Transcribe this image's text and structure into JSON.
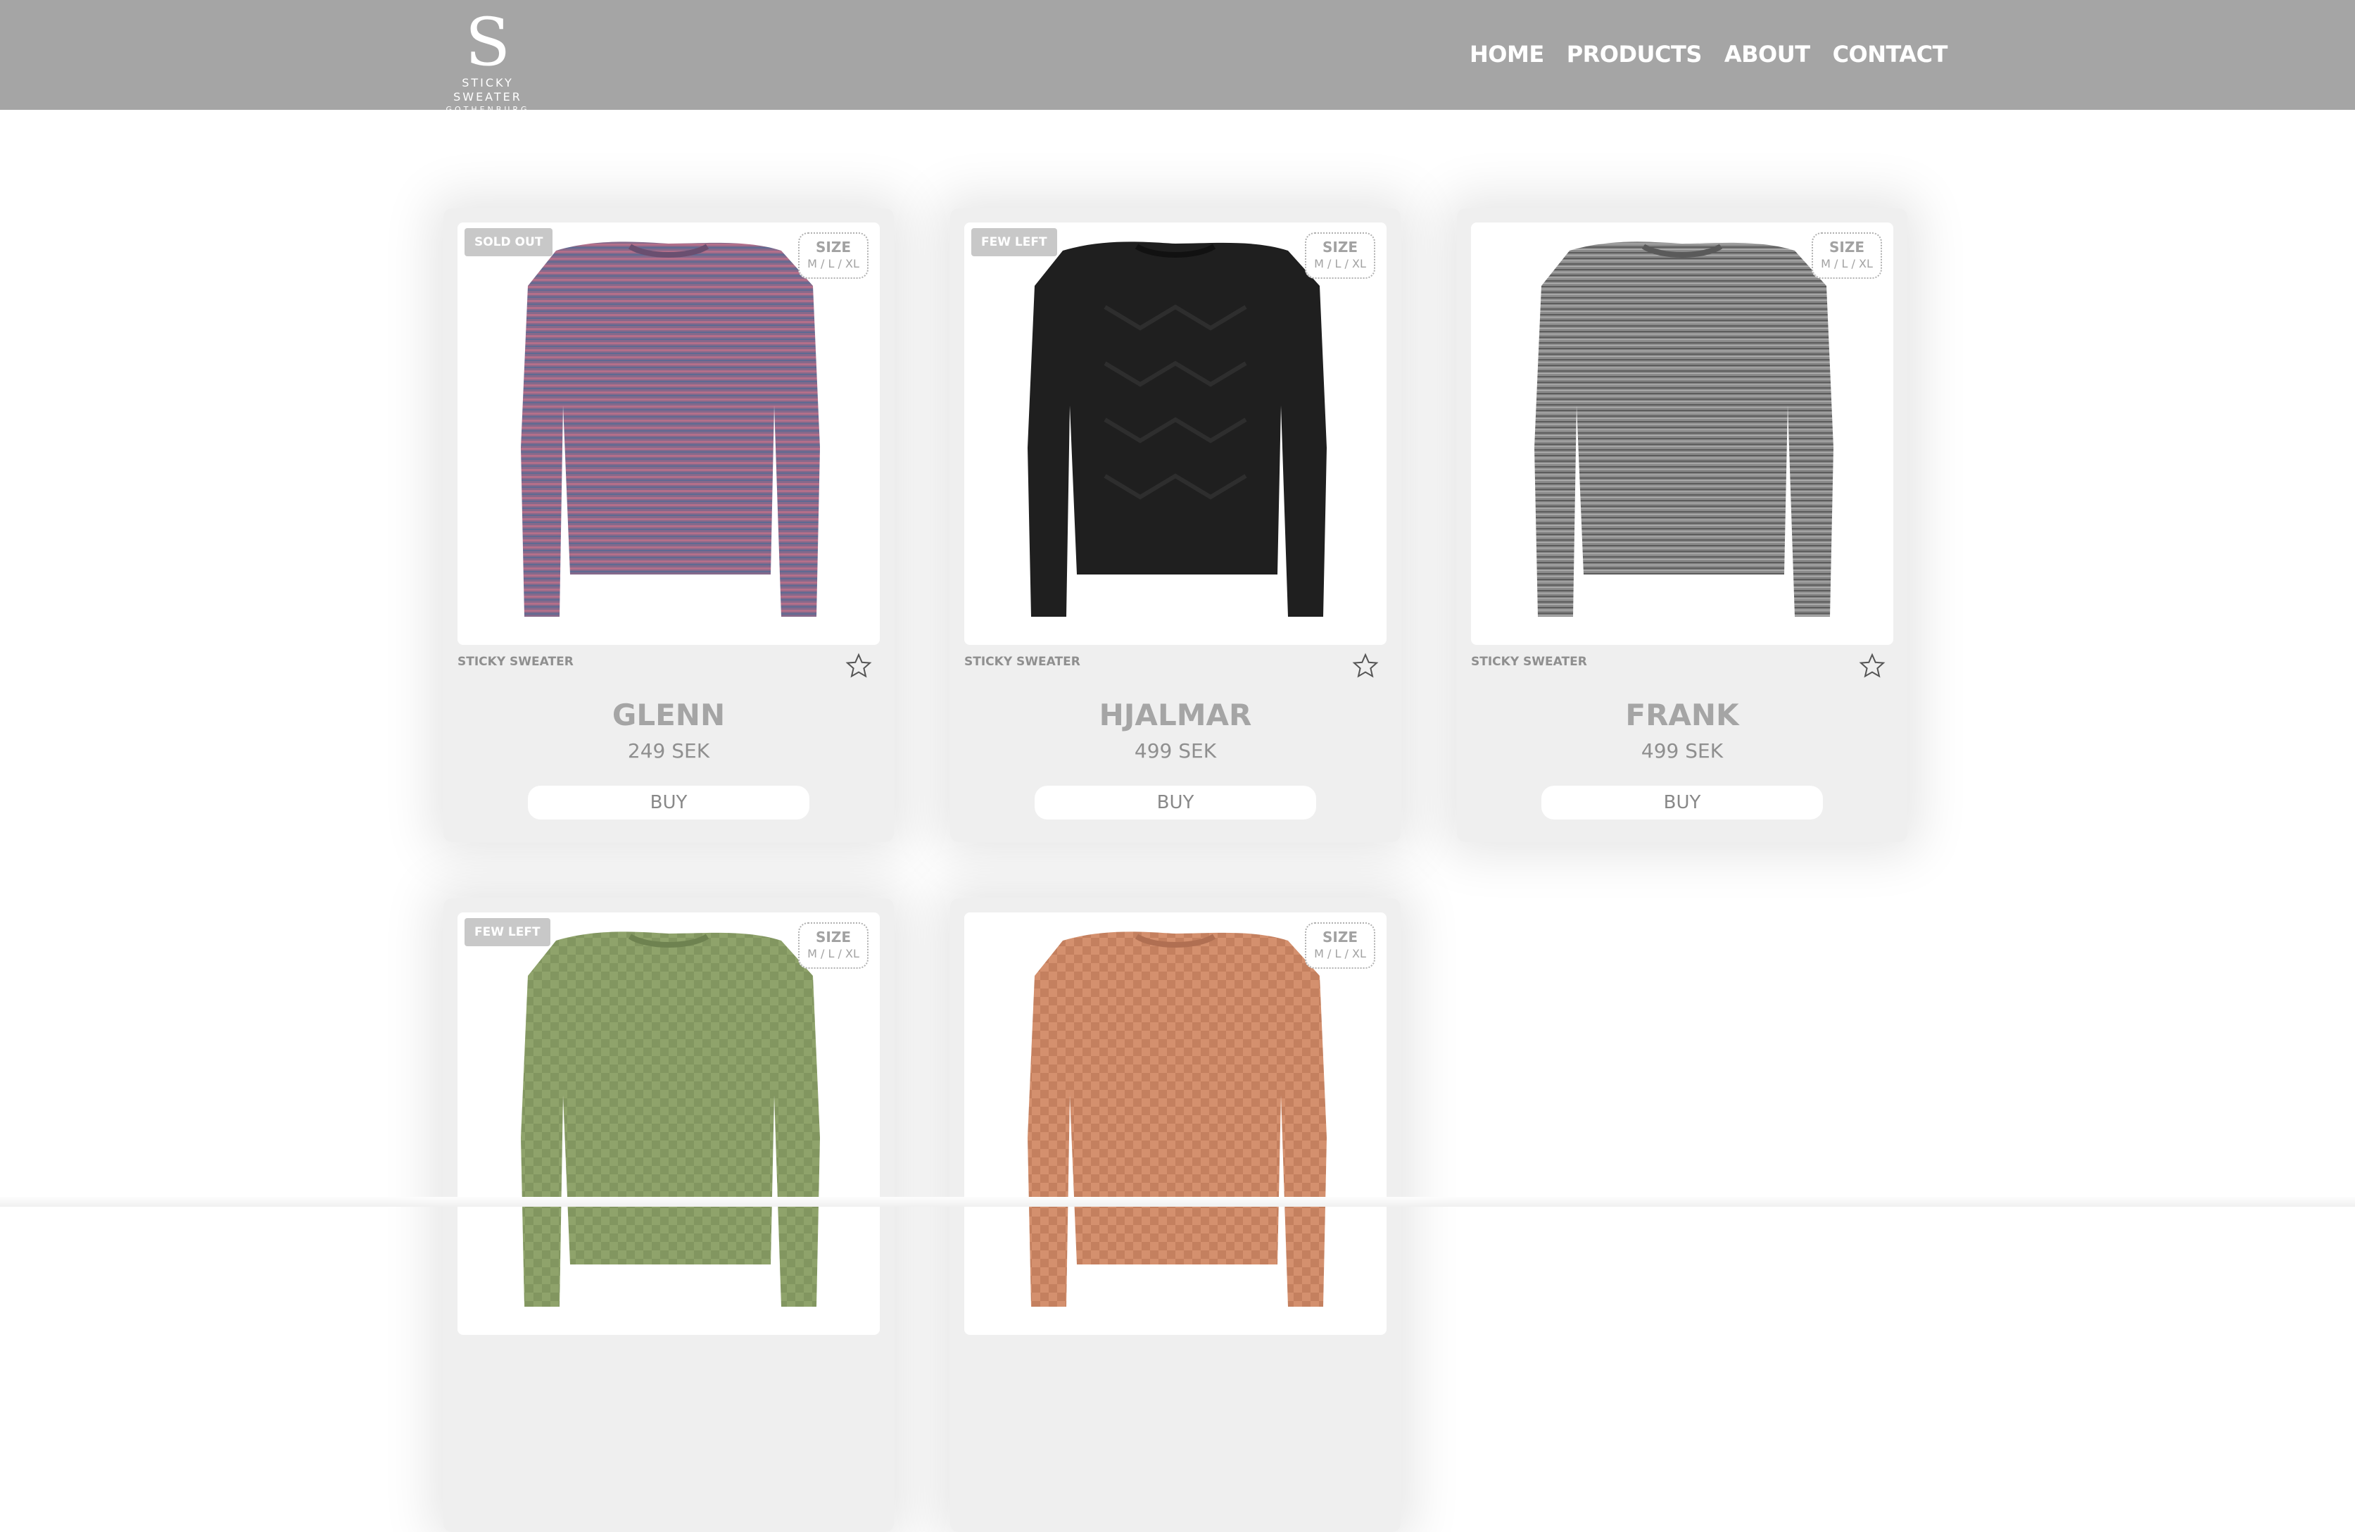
{
  "brand": {
    "logo_mark": "S",
    "name": "STICKY SWEATER",
    "city": "GOTHENBURG"
  },
  "nav": {
    "items": [
      {
        "label": "HOME"
      },
      {
        "label": "PRODUCTS"
      },
      {
        "label": "ABOUT"
      },
      {
        "label": "CONTACT"
      }
    ]
  },
  "colors": {
    "header_bg": "#a5a5a5",
    "card_bg": "#efefef",
    "badge_bg": "#c8c8c8"
  },
  "products": [
    {
      "badge": "SOLD OUT",
      "size_title": "SIZE",
      "size_values": "M / L / XL",
      "brand": "STICKY SWEATER",
      "name": "GLENN",
      "price": "249 SEK",
      "buy_label": "BUY",
      "icon": "star-icon",
      "color": "#8a6a86"
    },
    {
      "badge": "FEW LEFT",
      "size_title": "SIZE",
      "size_values": "M / L / XL",
      "brand": "STICKY SWEATER",
      "name": "HJALMAR",
      "price": "499 SEK",
      "buy_label": "BUY",
      "icon": "star-icon",
      "color": "#1e1e1e"
    },
    {
      "badge": "",
      "size_title": "SIZE",
      "size_values": "M / L / XL",
      "brand": "STICKY SWEATER",
      "name": "FRANK",
      "price": "499 SEK",
      "buy_label": "BUY",
      "icon": "star-icon",
      "color": "#7f7f7f"
    },
    {
      "badge": "FEW LEFT",
      "size_title": "SIZE",
      "size_values": "M / L / XL",
      "brand": "",
      "name": "",
      "price": "",
      "buy_label": "",
      "icon": "",
      "color": "#8ea26a"
    },
    {
      "badge": "",
      "size_title": "SIZE",
      "size_values": "M / L / XL",
      "brand": "",
      "name": "",
      "price": "",
      "buy_label": "",
      "icon": "",
      "color": "#d38f6e"
    }
  ]
}
